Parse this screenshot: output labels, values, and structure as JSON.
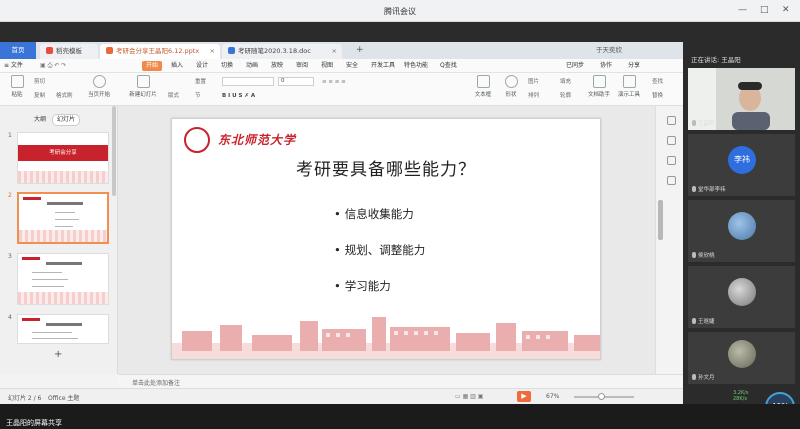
{
  "meeting": {
    "title": "腾讯会议",
    "min": "—",
    "max": "□",
    "close": "✕"
  },
  "tabs": [
    {
      "label": "首页"
    },
    {
      "label": "稻壳模板"
    },
    {
      "label": "考研会分享王晶阳6.12.pptx"
    },
    {
      "label": "考研随笔2020.3.18.doc"
    }
  ],
  "tab_add": "+",
  "tab_user": "于天奕欣",
  "menu": {
    "file": "≡ 文件",
    "items": [
      "开始",
      "插入",
      "设计",
      "切换",
      "动画",
      "放映",
      "审阅",
      "视图",
      "安全",
      "开发工具",
      "特色功能"
    ],
    "search": "Q查找",
    "sync": "已同步",
    "collab": "协作",
    "share": "分享"
  },
  "ribbon": {
    "paste": "粘贴",
    "cut": "剪切",
    "copy": "复制",
    "format_painter": "格式刷",
    "from_current": "当页开始",
    "new_slide": "新建幻灯片",
    "layout": "版式",
    "section": "节",
    "reset": "重置",
    "font_size": "0",
    "textbox": "文本框",
    "shape": "形状",
    "arrange": "排列",
    "picture": "图片",
    "fill": "填充",
    "outline": "轮廓",
    "doc_assistant": "文档助手",
    "present_tools": "演示工具",
    "find": "查找",
    "replace": "替换"
  },
  "thumbs": {
    "tab_outline": "大纲",
    "tab_slides": "幻灯片",
    "numbers": [
      "1",
      "2",
      "3",
      "4"
    ],
    "slide1_title": "考研会分享",
    "add": "+"
  },
  "slide": {
    "logo_text": "东北师范大学",
    "title": "考研要具备哪些能力？",
    "bullets": [
      "信息收集能力",
      "规划、调整能力",
      "学习能力"
    ]
  },
  "notes": {
    "placeholder": "单击此处添加备注"
  },
  "status": {
    "slide_index": "幻灯片 2 / 6",
    "theme": "Office 主题",
    "zoom": "67%",
    "zoom_fraction": 0.45
  },
  "panel": {
    "speaking": "正在讲话: 王晶阳",
    "participants": [
      {
        "name": "王晶阳",
        "avatar_text": ""
      },
      {
        "name": "堂华部李祎",
        "avatar_text": "李祎"
      },
      {
        "name": "侯欣桃",
        "avatar_text": ""
      },
      {
        "name": "王晗婕",
        "avatar_text": ""
      },
      {
        "name": "孙文月",
        "avatar_text": ""
      }
    ],
    "net_up": "3.2K/s",
    "net_down": "28K/s",
    "cpu": "40%"
  },
  "share": {
    "label": "王晶阳的屏幕共享"
  },
  "colors": {
    "accent": "#3b74d9",
    "brand_red": "#c8232c",
    "start_orange": "#f08a4a"
  }
}
